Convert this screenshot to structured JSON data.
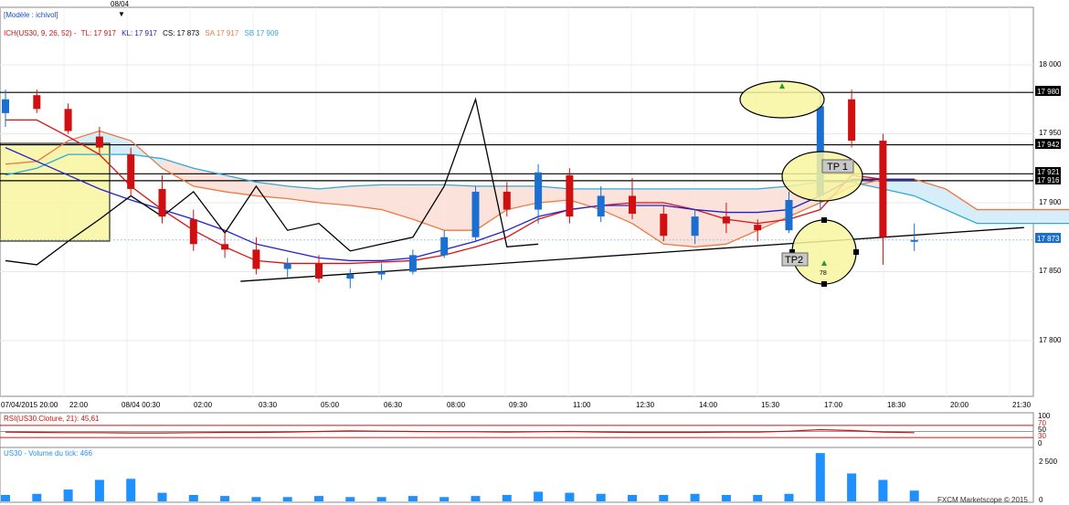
{
  "header": {
    "date_marker": "08/04",
    "model": "[Modèle : ichivol]",
    "ichimoku_label": "ICH(US30, 9, 26, 52) -",
    "tl": "TL: 17 917",
    "kl": "KL: 17 917",
    "cs": "CS: 17 873",
    "sa": "SA  17 917",
    "sb": "SB  17 909"
  },
  "colors": {
    "tenkan": "#e01010",
    "kijun": "#2020d0",
    "chikou": "#000000",
    "senkou_a": "#f07840",
    "senkou_b": "#30a8d8",
    "bull": "#1a6fd0",
    "bear": "#d01010",
    "cloud_bear": "#fbe3dc",
    "cloud_bull": "#d6eefa",
    "highlight": "#f8f4a0",
    "volume": "#1e90ff"
  },
  "price_axis": {
    "ticks": [
      "18 000",
      "17 950",
      "17 900",
      "17 850",
      "17 800"
    ],
    "current_price": "17 873",
    "level_labels": [
      "17 980",
      "17 942",
      "17 921",
      "17 916"
    ]
  },
  "time_axis": [
    "07/04/2015 20:00",
    "22:00",
    "08/04 00:30",
    "02:00",
    "03:30",
    "05:00",
    "06:30",
    "08:00",
    "09:30",
    "11:00",
    "12:30",
    "14:00",
    "15:30",
    "17:00",
    "18:30",
    "20:00",
    "21:30"
  ],
  "annotations": {
    "tp1": "TP 1",
    "tp2": "TP2",
    "arrow_count": "78"
  },
  "rsi": {
    "label": "RSI(US30.Cloture, 21): 45,61",
    "ticks": [
      "100",
      "70",
      "50",
      "30",
      "0"
    ]
  },
  "volume": {
    "label": "US30 - Volume du tick: 466",
    "ticks": [
      "2 500",
      "0"
    ]
  },
  "footer": "FXCM Marketscope © 2015",
  "chart_data": {
    "type": "candlestick",
    "ylim": [
      17762,
      18032
    ],
    "horizontal_levels": [
      17980,
      17942,
      17921,
      17916
    ],
    "trendline": [
      [
        7.5,
        17843
      ],
      [
        32.5,
        17882
      ]
    ],
    "candles": [
      {
        "o": 17965,
        "h": 17982,
        "l": 17955,
        "c": 17975
      },
      {
        "o": 17978,
        "h": 17982,
        "l": 17965,
        "c": 17968
      },
      {
        "o": 17968,
        "h": 17972,
        "l": 17950,
        "c": 17952
      },
      {
        "o": 17948,
        "h": 17955,
        "l": 17935,
        "c": 17940
      },
      {
        "o": 17935,
        "h": 17940,
        "l": 17905,
        "c": 17910
      },
      {
        "o": 17910,
        "h": 17920,
        "l": 17885,
        "c": 17890
      },
      {
        "o": 17888,
        "h": 17895,
        "l": 17865,
        "c": 17870
      },
      {
        "o": 17870,
        "h": 17880,
        "l": 17860,
        "c": 17866
      },
      {
        "o": 17866,
        "h": 17875,
        "l": 17848,
        "c": 17852
      },
      {
        "o": 17852,
        "h": 17860,
        "l": 17846,
        "c": 17856
      },
      {
        "o": 17856,
        "h": 17862,
        "l": 17842,
        "c": 17845
      },
      {
        "o": 17845,
        "h": 17852,
        "l": 17838,
        "c": 17848
      },
      {
        "o": 17848,
        "h": 17856,
        "l": 17844,
        "c": 17850
      },
      {
        "o": 17850,
        "h": 17866,
        "l": 17848,
        "c": 17862
      },
      {
        "o": 17862,
        "h": 17880,
        "l": 17860,
        "c": 17875
      },
      {
        "o": 17875,
        "h": 17912,
        "l": 17872,
        "c": 17908
      },
      {
        "o": 17908,
        "h": 17915,
        "l": 17890,
        "c": 17895
      },
      {
        "o": 17895,
        "h": 17928,
        "l": 17885,
        "c": 17922
      },
      {
        "o": 17920,
        "h": 17925,
        "l": 17885,
        "c": 17890
      },
      {
        "o": 17890,
        "h": 17912,
        "l": 17886,
        "c": 17905
      },
      {
        "o": 17905,
        "h": 17918,
        "l": 17888,
        "c": 17892
      },
      {
        "o": 17892,
        "h": 17898,
        "l": 17872,
        "c": 17876
      },
      {
        "o": 17876,
        "h": 17895,
        "l": 17870,
        "c": 17890
      },
      {
        "o": 17890,
        "h": 17900,
        "l": 17878,
        "c": 17885
      },
      {
        "o": 17884,
        "h": 17888,
        "l": 17872,
        "c": 17880
      },
      {
        "o": 17880,
        "h": 17908,
        "l": 17878,
        "c": 17902
      },
      {
        "o": 17905,
        "h": 17980,
        "l": 17895,
        "c": 17970
      },
      {
        "o": 17975,
        "h": 17982,
        "l": 17940,
        "c": 17945
      },
      {
        "o": 17945,
        "h": 17950,
        "l": 17855,
        "c": 17875
      },
      {
        "o": 17873,
        "h": 17885,
        "l": 17865,
        "c": 17873
      }
    ],
    "tenkan": [
      17960,
      17960,
      17948,
      17935,
      17912,
      17895,
      17880,
      17868,
      17858,
      17856,
      17856,
      17856,
      17857,
      17858,
      17862,
      17868,
      17875,
      17888,
      17895,
      17898,
      17900,
      17900,
      17895,
      17888,
      17885,
      17888,
      17895,
      17920,
      17917,
      17917
    ],
    "kijun": [
      17940,
      17930,
      17920,
      17910,
      17902,
      17895,
      17888,
      17880,
      17870,
      17865,
      17860,
      17858,
      17858,
      17860,
      17866,
      17872,
      17880,
      17890,
      17895,
      17898,
      17898,
      17898,
      17895,
      17893,
      17893,
      17895,
      17905,
      17917,
      17917,
      17917
    ],
    "senkou_a": [
      17928,
      17930,
      17945,
      17952,
      17945,
      17925,
      17912,
      17908,
      17905,
      17903,
      17900,
      17898,
      17895,
      17888,
      17880,
      17880,
      17895,
      17900,
      17902,
      17895,
      17885,
      17870,
      17868,
      17870,
      17880,
      17890,
      17900,
      17912,
      17917,
      17917,
      17910,
      17895,
      17895,
      17895,
      17895,
      17895
    ],
    "senkou_b": [
      17920,
      17925,
      17935,
      17935,
      17935,
      17932,
      17925,
      17920,
      17915,
      17912,
      17910,
      17912,
      17913,
      17913,
      17913,
      17912,
      17912,
      17912,
      17910,
      17910,
      17910,
      17910,
      17910,
      17910,
      17910,
      17912,
      17915,
      17915,
      17910,
      17905,
      17895,
      17885,
      17885,
      17885,
      17885,
      17885
    ],
    "chikou": [
      17858,
      17855,
      17872,
      17888,
      17905,
      17890,
      17908,
      17878,
      17912,
      17880,
      17885,
      17865,
      17870,
      17875,
      17912,
      17975,
      17868,
      17870
    ],
    "rsi": [
      48,
      47,
      46,
      46,
      45,
      45,
      46,
      47,
      47,
      48,
      50,
      52,
      51,
      50,
      49,
      49,
      48,
      49,
      50,
      48,
      47,
      47,
      47,
      48,
      48,
      51,
      56,
      53,
      48,
      46
    ],
    "volume": [
      30,
      35,
      55,
      100,
      105,
      40,
      30,
      25,
      20,
      20,
      25,
      20,
      20,
      25,
      20,
      25,
      30,
      45,
      40,
      35,
      30,
      30,
      35,
      30,
      30,
      35,
      225,
      130,
      100,
      50
    ]
  }
}
